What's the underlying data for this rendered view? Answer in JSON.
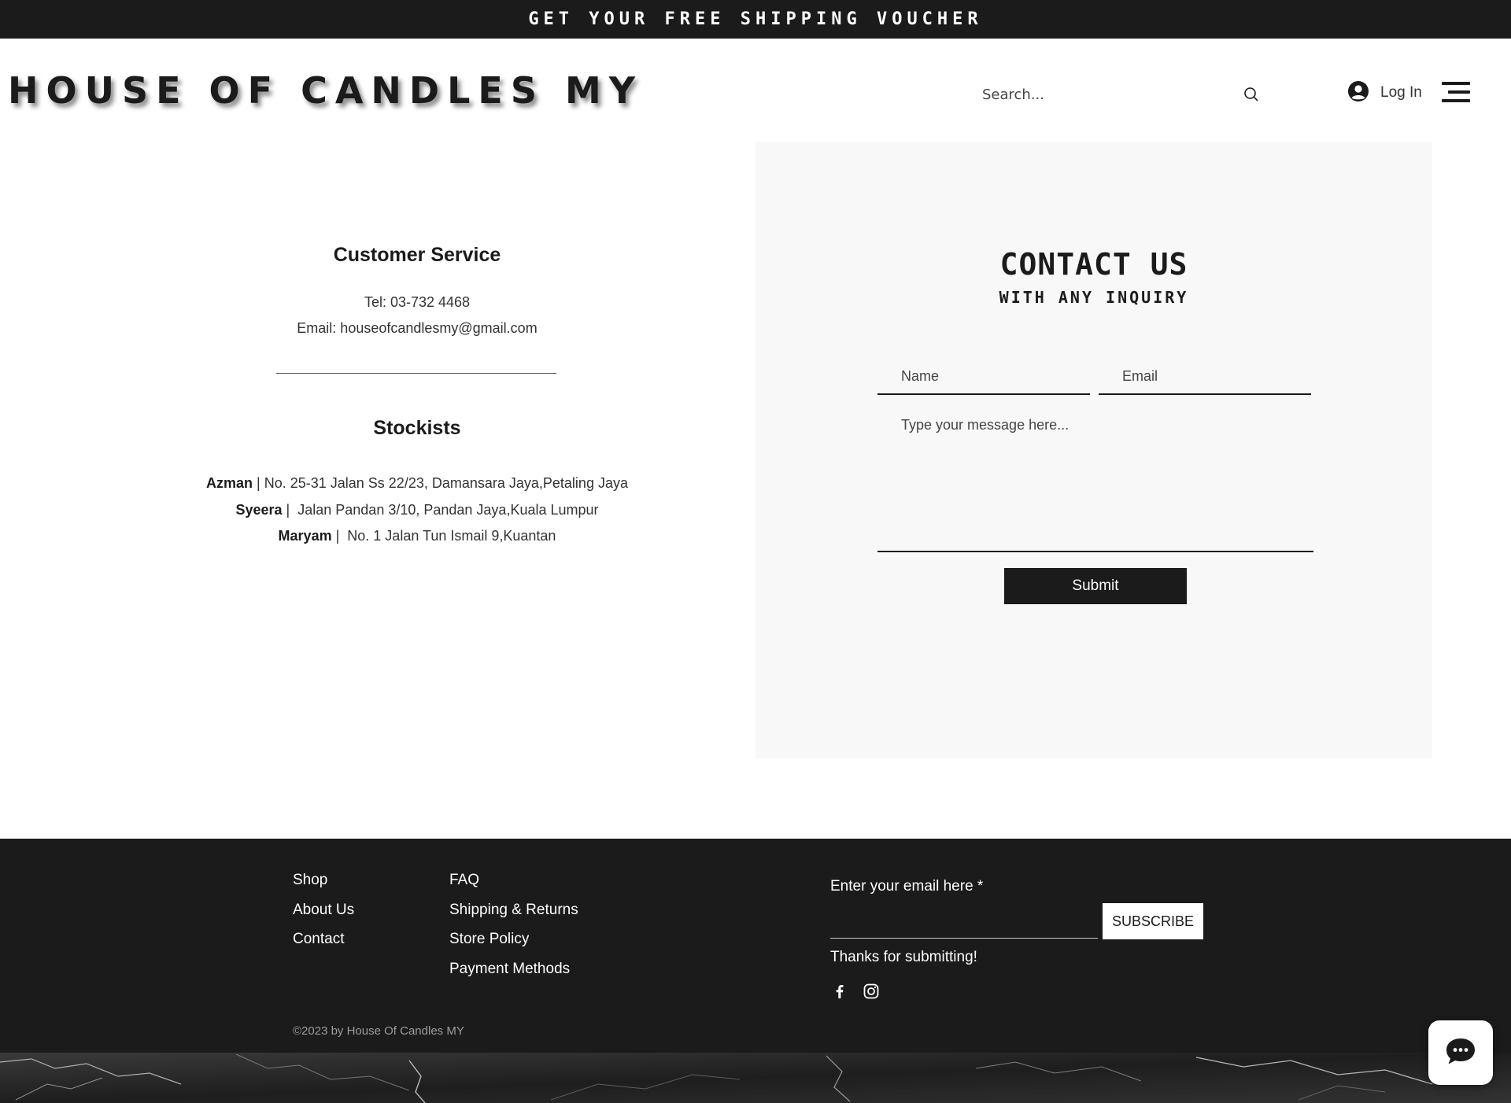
{
  "announcement": {
    "text": "GET YOUR FREE SHIPPING VOUCHER"
  },
  "header": {
    "logo": "HOUSE OF CANDLES MY",
    "search_placeholder": "Search...",
    "search_icon": "search-icon",
    "login_label": "Log In",
    "login_icon": "user-avatar-icon",
    "menu_icon": "hamburger-menu-icon"
  },
  "customer_service": {
    "title": "Customer Service",
    "tel": "Tel: 03-732 4468",
    "email": "Email: houseofcandlesmy@gmail.com"
  },
  "stockists": {
    "title": "Stockists",
    "items": [
      {
        "name": "Azman",
        "separator": " | ",
        "address": "No. 25-31 Jalan Ss 22/23, Damansara Jaya,Petaling Jaya"
      },
      {
        "name": "Syeera",
        "separator": " |  ",
        "address": "Jalan Pandan 3/10, Pandan Jaya,Kuala Lumpur"
      },
      {
        "name": "Maryam",
        "separator": " |  ",
        "address": "No. 1 Jalan Tun Ismail 9,Kuantan"
      }
    ]
  },
  "contact_form": {
    "title": "CONTACT US",
    "subtitle": "WITH ANY INQUIRY",
    "name_placeholder": "Name",
    "email_placeholder": "Email",
    "message_placeholder": "Type your message here...",
    "submit_label": "Submit"
  },
  "footer": {
    "links_col1": [
      "Shop",
      "About Us",
      "Contact"
    ],
    "links_col2": [
      "FAQ",
      "Shipping & Returns",
      "Store Policy",
      "Payment Methods"
    ],
    "email_label": "Enter your email here *",
    "subscribe_label": "SUBSCRIBE",
    "thanks": "Thanks for submitting!",
    "social_icons": [
      "facebook-icon",
      "instagram-icon"
    ],
    "copyright": "©2023 by House Of Candles MY"
  },
  "chat": {
    "icon": "chat-bubble-icon"
  },
  "colors": {
    "dark": "#1b1b1b",
    "panel": "#f8f8f8",
    "white": "#ffffff"
  }
}
